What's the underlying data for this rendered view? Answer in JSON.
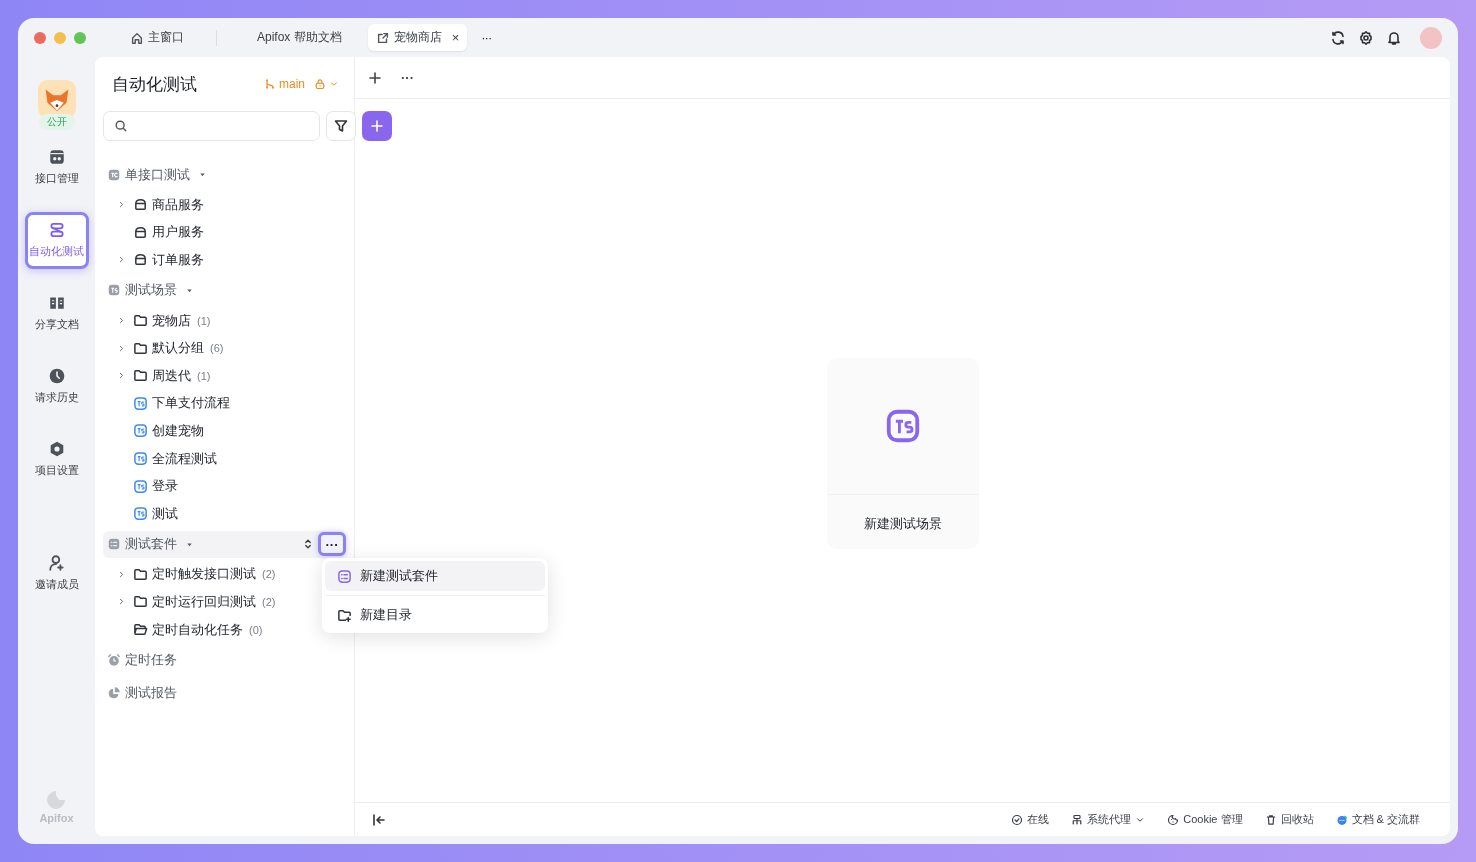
{
  "window": {
    "tabs": [
      {
        "kind": "home",
        "label": "主窗口",
        "selected": false
      },
      {
        "kind": "plain",
        "label": "Apifox 帮助文档",
        "selected": false
      },
      {
        "kind": "project",
        "label": "宠物商店",
        "selected": true,
        "close": "×"
      }
    ],
    "more": "···"
  },
  "rail": {
    "project_badge": "公开",
    "items": [
      {
        "kind": "api",
        "label": "接口管理",
        "selected": false
      },
      {
        "kind": "auto",
        "label": "自动化测试",
        "selected": true
      },
      {
        "kind": "book",
        "label": "分享文档",
        "selected": false
      },
      {
        "kind": "clock",
        "label": "请求历史",
        "selected": false
      },
      {
        "kind": "hex",
        "label": "项目设置",
        "selected": false
      }
    ],
    "invite": {
      "label": "邀请成员"
    },
    "brand": "Apifox"
  },
  "panel": {
    "title": "自动化测试",
    "branch": "main",
    "sections": [
      {
        "kind": "tc",
        "label": "单接口测试",
        "expanded": true,
        "selected": false,
        "children": [
          {
            "kind": "service",
            "label": "商品服务",
            "expanded": false
          },
          {
            "kind": "service",
            "label": "用户服务"
          },
          {
            "kind": "service",
            "label": "订单服务",
            "expanded": false
          }
        ]
      },
      {
        "kind": "ts",
        "label": "测试场景",
        "expanded": true,
        "selected": false,
        "children": [
          {
            "kind": "folder",
            "label": "宠物店",
            "count": "(1)",
            "expanded": false
          },
          {
            "kind": "folder",
            "label": "默认分组",
            "count": "(6)",
            "expanded": false
          },
          {
            "kind": "folder",
            "label": "周迭代",
            "count": "(1)",
            "expanded": false
          },
          {
            "kind": "ts",
            "label": "下单支付流程"
          },
          {
            "kind": "ts",
            "label": "创建宠物"
          },
          {
            "kind": "ts",
            "label": "全流程测试"
          },
          {
            "kind": "ts",
            "label": "登录"
          },
          {
            "kind": "ts",
            "label": "测试"
          }
        ]
      },
      {
        "kind": "suite",
        "label": "测试套件",
        "expanded": true,
        "selected": true,
        "more": "···",
        "children": [
          {
            "kind": "folder",
            "label": "定时触发接口测试",
            "count": "(2)",
            "expanded": false
          },
          {
            "kind": "folder",
            "label": "定时运行回归测试",
            "count": "(2)",
            "expanded": false
          },
          {
            "kind": "folder-open",
            "label": "定时自动化任务",
            "count": "(0)"
          }
        ]
      },
      {
        "kind": "alarm",
        "label": "定时任务",
        "selected": false
      },
      {
        "kind": "pie",
        "label": "测试报告",
        "selected": false
      }
    ]
  },
  "menu": [
    {
      "kind": "suite",
      "label": "新建测试套件",
      "selected": true
    },
    {
      "kind": "folder-add",
      "label": "新建目录",
      "selected": false
    }
  ],
  "main": {
    "toolbar_more": "···",
    "empty_card": {
      "label": "新建测试场景"
    }
  },
  "status_bar": [
    {
      "kind": "check",
      "label": "在线"
    },
    {
      "kind": "proxy",
      "label": "系统代理",
      "dropdown": true
    },
    {
      "kind": "cookie",
      "label": "Cookie 管理"
    },
    {
      "kind": "trash",
      "label": "回收站"
    },
    {
      "kind": "chat",
      "label": "文档 & 交流群"
    }
  ]
}
